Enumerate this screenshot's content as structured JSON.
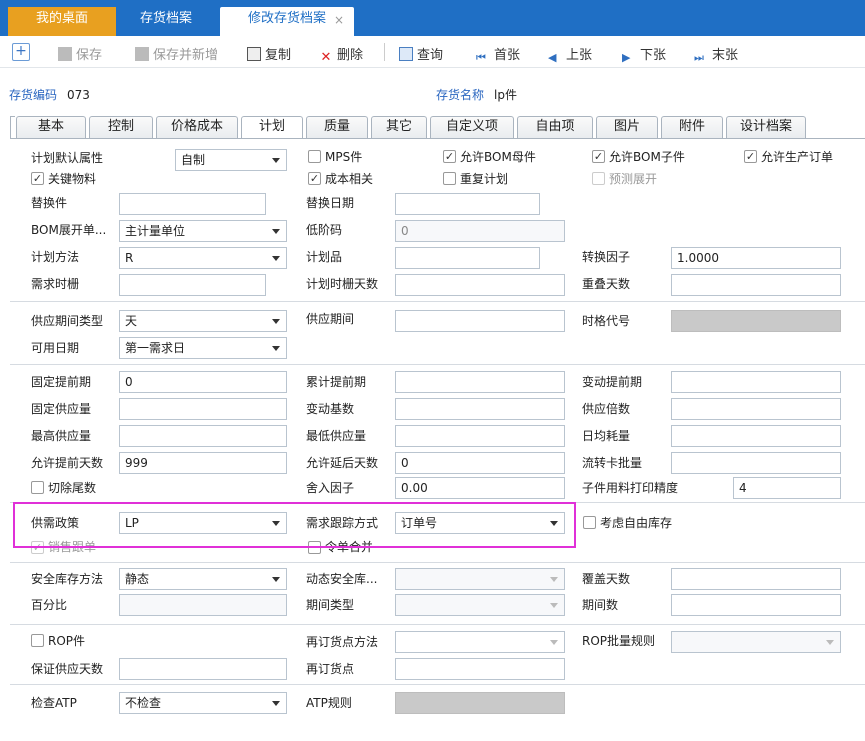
{
  "tabs": {
    "home": "我的桌面",
    "archive": "存货档案",
    "edit": "修改存货档案",
    "close": "×"
  },
  "toolbar": {
    "save": "保存",
    "save_new": "保存并新增",
    "copy": "复制",
    "delete": "删除",
    "query": "查询",
    "first": "首张",
    "prev": "上张",
    "next": "下张",
    "last": "末张"
  },
  "header": {
    "code_label": "存货编码",
    "code_value": "073",
    "name_label": "存货名称",
    "name_value": "lp件"
  },
  "subtabs": [
    "基本",
    "控制",
    "价格成本",
    "计划",
    "质量",
    "其它",
    "自定义项",
    "自由项",
    "图片",
    "附件",
    "设计档案"
  ],
  "checks": {
    "mps": "MPS件",
    "allow_bom_parent": "允许BOM母件",
    "allow_bom_child": "允许BOM子件",
    "allow_prod_order": "允许生产订单",
    "key_material": "关键物料",
    "cost_related": "成本相关",
    "repeat_plan": "重复计划",
    "forecast_expand": "预测展开",
    "cut_tail": "切除尾数",
    "consider_free_stock": "考虑自由库存",
    "sales_track": "销售跟单",
    "order_merge": "令单合并",
    "rop": "ROP件"
  },
  "labels": {
    "default_attr": "计划默认属性",
    "replace_part": "替换件",
    "replace_date": "替换日期",
    "bom_expand": "BOM展开单...",
    "low_level": "低阶码",
    "plan_method": "计划方法",
    "plan_item": "计划品",
    "convert_factor": "转换因子",
    "demand_fence": "需求时栅",
    "plan_fence_days": "计划时栅天数",
    "overlap_days": "重叠天数",
    "supply_period_type": "供应期间类型",
    "supply_period": "供应期间",
    "time_code": "时格代号",
    "avail_date": "可用日期",
    "fixed_lead": "固定提前期",
    "cum_lead": "累计提前期",
    "var_lead": "变动提前期",
    "fixed_supply": "固定供应量",
    "var_base": "变动基数",
    "supply_multiple": "供应倍数",
    "max_supply": "最高供应量",
    "min_supply": "最低供应量",
    "daily_consume": "日均耗量",
    "allow_ahead_days": "允许提前天数",
    "allow_delay_days": "允许延后天数",
    "transfer_batch": "流转卡批量",
    "round_factor": "舍入因子",
    "print_precision": "子件用料打印精度",
    "supply_policy": "供需政策",
    "demand_track": "需求跟踪方式",
    "safety_method": "安全库存方法",
    "dyn_safety": "动态安全库...",
    "cover_days": "覆盖天数",
    "percent": "百分比",
    "period_type": "期间类型",
    "period_count": "期间数",
    "reorder_method": "再订货点方法",
    "rop_batch_rule": "ROP批量规则",
    "guarantee_days": "保证供应天数",
    "reorder_point": "再订货点",
    "check_atp": "检查ATP",
    "atp_rule": "ATP规则"
  },
  "values": {
    "default_attr": "自制",
    "bom_expand": "主计量单位",
    "low_level": "0",
    "plan_method": "R",
    "convert_factor": "1.0000",
    "supply_period_type": "天",
    "avail_date": "第一需求日",
    "fixed_lead": "0",
    "allow_ahead_days": "999",
    "allow_delay_days": "0",
    "round_factor": "0.00",
    "print_precision": "4",
    "supply_policy": "LP",
    "demand_track": "订单号",
    "safety_method": "静态",
    "check_atp": "不检查"
  }
}
